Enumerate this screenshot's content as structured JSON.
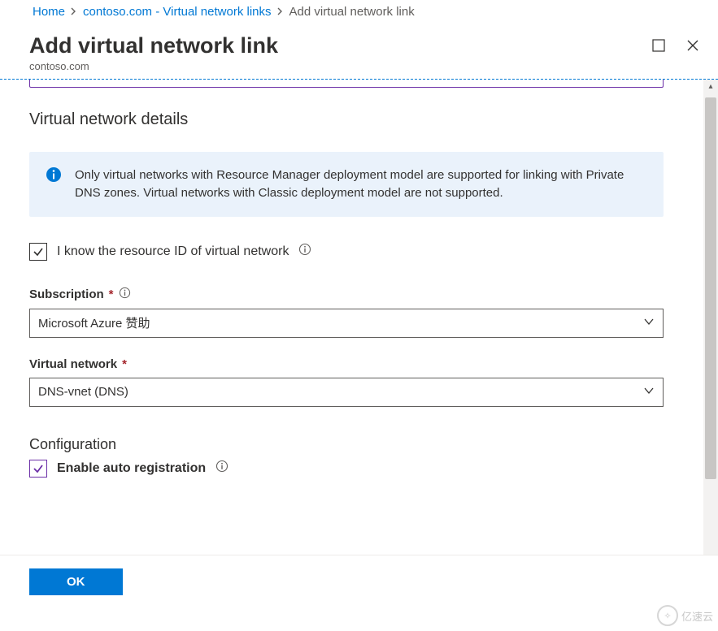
{
  "breadcrumb": {
    "home": "Home",
    "links_page": "contoso.com - Virtual network links",
    "current": "Add virtual network link"
  },
  "header": {
    "title": "Add virtual network link",
    "subtitle": "contoso.com"
  },
  "section": {
    "vnet_details": "Virtual network details",
    "info_text": "Only virtual networks with Resource Manager deployment model are supported for linking with Private DNS zones. Virtual networks with Classic deployment model are not supported.",
    "know_resource_id": "I know the resource ID of virtual network",
    "subscription_label": "Subscription",
    "subscription_value": "Microsoft Azure 赞助",
    "vnet_label": "Virtual network",
    "vnet_value": "DNS-vnet (DNS)",
    "configuration_label": "Configuration",
    "enable_auto_reg": "Enable auto registration"
  },
  "footer": {
    "ok": "OK"
  },
  "watermark": "亿速云"
}
